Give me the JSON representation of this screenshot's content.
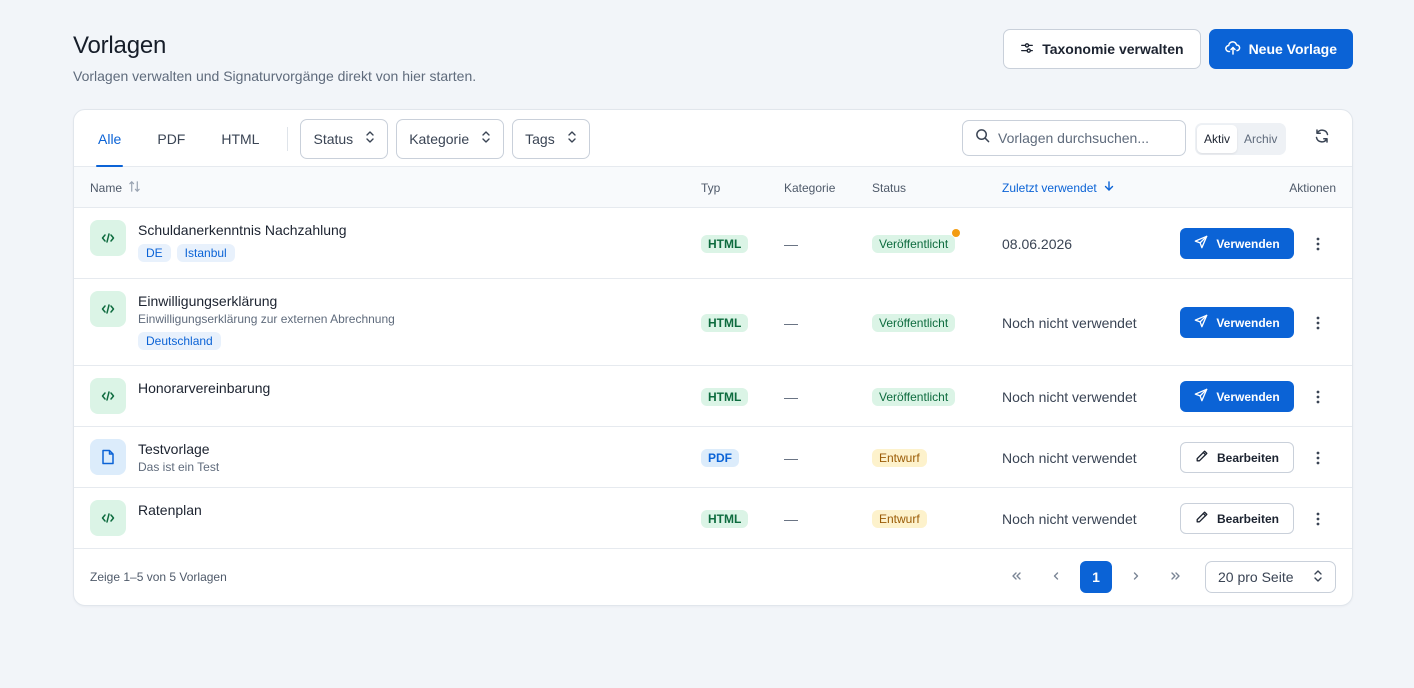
{
  "header": {
    "title": "Vorlagen",
    "subtitle": "Vorlagen verwalten und Signaturvorgänge direkt von hier starten.",
    "taxonomy_label": "Taxonomie verwalten",
    "new_label": "Neue Vorlage"
  },
  "toolbar": {
    "tabs": [
      "Alle",
      "PDF",
      "HTML"
    ],
    "active_tab": "Alle",
    "filters": [
      "Status",
      "Kategorie",
      "Tags"
    ],
    "search_placeholder": "Vorlagen durchsuchen...",
    "segment": [
      "Aktiv",
      "Archiv"
    ],
    "active_segment": "Aktiv"
  },
  "columns": {
    "name": "Name",
    "type": "Typ",
    "category": "Kategorie",
    "status": "Status",
    "last_used": "Zuletzt verwendet",
    "actions": "Aktionen"
  },
  "rows": [
    {
      "name": "Schuldanerkenntnis Nachzahlung",
      "description": "",
      "tags": [
        "DE",
        "Istanbul"
      ],
      "type": "HTML",
      "category": "—",
      "status": "Veröffentlicht",
      "status_dot": true,
      "last_used": "08.06.2026",
      "action": "Verwenden"
    },
    {
      "name": "Einwilligungserklärung",
      "description": "Einwilligungserklärung zur externen Abrechnung",
      "tags": [
        "Deutschland"
      ],
      "type": "HTML",
      "category": "—",
      "status": "Veröffentlicht",
      "status_dot": false,
      "last_used": "Noch nicht verwendet",
      "action": "Verwenden"
    },
    {
      "name": "Honorarvereinbarung",
      "description": "",
      "tags": [],
      "type": "HTML",
      "category": "—",
      "status": "Veröffentlicht",
      "status_dot": false,
      "last_used": "Noch nicht verwendet",
      "action": "Verwenden"
    },
    {
      "name": "Testvorlage",
      "description": "Das ist ein Test",
      "tags": [],
      "type": "PDF",
      "category": "—",
      "status": "Entwurf",
      "status_dot": false,
      "last_used": "Noch nicht verwendet",
      "action": "Bearbeiten"
    },
    {
      "name": "Ratenplan",
      "description": "",
      "tags": [],
      "type": "HTML",
      "category": "—",
      "status": "Entwurf",
      "status_dot": false,
      "last_used": "Noch nicht verwendet",
      "action": "Bearbeiten"
    }
  ],
  "footer": {
    "info": "Zeige 1–5 von 5 Vorlagen",
    "current_page": "1",
    "per_page": "20 pro Seite"
  },
  "colors": {
    "accent": "#0b63d6",
    "published_bg": "#dbf4e6",
    "draft_bg": "#fdf2cc",
    "notification_dot": "#f39c12"
  }
}
